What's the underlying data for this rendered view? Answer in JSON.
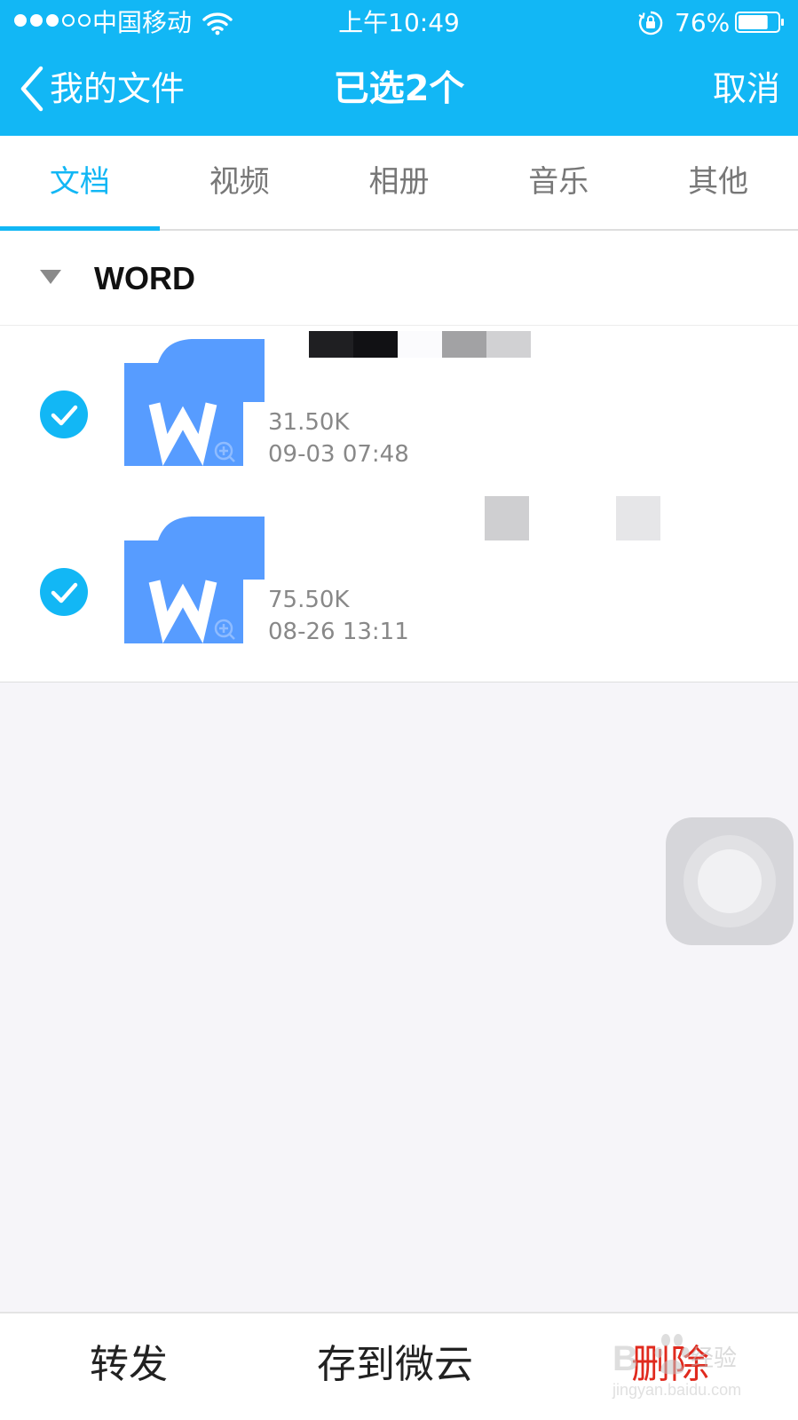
{
  "status_bar": {
    "carrier": "中国移动",
    "time": "上午10:49",
    "battery_percent": "76%",
    "battery_level": 0.76,
    "icons": [
      "signal-dots",
      "wifi-icon",
      "orientation-lock-icon",
      "battery-icon"
    ]
  },
  "nav": {
    "back_label": "我的文件",
    "title": "已选2个",
    "cancel_label": "取消"
  },
  "tabs": [
    {
      "label": "文档",
      "active": true
    },
    {
      "label": "视频",
      "active": false
    },
    {
      "label": "相册",
      "active": false
    },
    {
      "label": "音乐",
      "active": false
    },
    {
      "label": "其他",
      "active": false
    }
  ],
  "section": {
    "title": "WORD",
    "icon": "collapse-triangle-icon"
  },
  "files": [
    {
      "size": "31.50K",
      "date": "09-03 07:48",
      "selected": true,
      "icon": "word-file-icon"
    },
    {
      "size": "75.50K",
      "date": "08-26 13:11",
      "selected": true,
      "icon": "word-file-icon"
    }
  ],
  "bottom_bar": {
    "forward_label": "转发",
    "save_label": "存到微云",
    "delete_label": "删除"
  },
  "watermark": {
    "text": "经验",
    "url": "jingyan.baidu.com"
  },
  "colors": {
    "accent": "#12b7f5",
    "delete": "#e02a1e",
    "word_icon": "#579cff"
  }
}
